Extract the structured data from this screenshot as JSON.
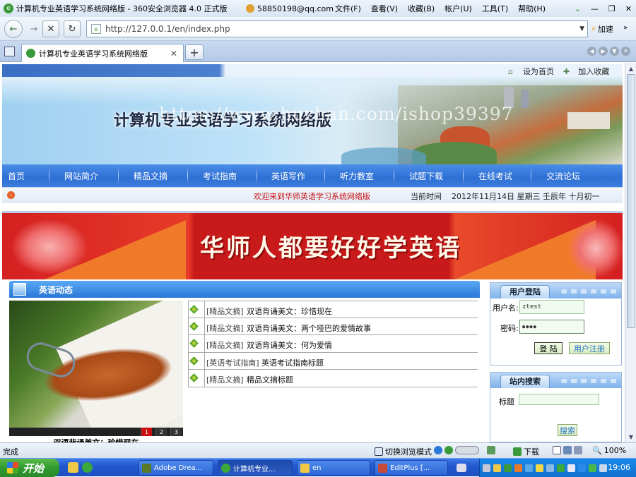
{
  "window": {
    "title": "计算机专业英语学习系统网络版 - 360安全浏览器 4.0 正式版",
    "account": "58850198@qq.com",
    "menus": [
      "文件(F)",
      "查看(V)",
      "收藏(B)",
      "帐户(U)",
      "工具(T)",
      "帮助(H)"
    ],
    "controls": [
      "⌄",
      "—",
      "❐",
      "✕"
    ]
  },
  "toolbar": {
    "url": "http://127.0.0.1/en/index.php",
    "accelerate_label": "加速",
    "more": "»"
  },
  "tabs": [
    {
      "label": "计算机专业英语学习系统网络版",
      "close": "✕"
    }
  ],
  "page": {
    "top_links": [
      "设为首页",
      "加入收藏"
    ],
    "site_title": "计算机专业英语学习系统网络版",
    "watermark": "https://www.huzhan.com/ishop39397",
    "nav": [
      "首页",
      "网站简介",
      "精品文摘",
      "考试指南",
      "英语写作",
      "听力教室",
      "试题下载",
      "在线考试",
      "交流论坛"
    ],
    "welcome": "欢迎来到华师英语学习系统网络版",
    "time_label": "当前时间",
    "time_value": "2012年11月14日  星期三  壬辰年  十月初一",
    "slogan": "华师人都要好好学英语",
    "news_section_title": "英语动态",
    "slide_numbers": [
      "1",
      "2",
      "3"
    ],
    "active_slide": "1",
    "slide_caption": "双语背诵美文：珍惜现在",
    "news": [
      {
        "category": "[精品文摘]",
        "title": "双语背诵美文：珍惜现在"
      },
      {
        "category": "[精品文摘]",
        "title": "双语背诵美文：两个哑巴的爱情故事"
      },
      {
        "category": "[精品文摘]",
        "title": "双语背诵美文：何为爱情"
      },
      {
        "category": "[英语考试指南]",
        "title": "英语考试指南标题"
      },
      {
        "category": "[精品文摘]",
        "title": "精品文摘标题"
      }
    ],
    "login": {
      "title": "用户登陆",
      "username_label": "用户名:",
      "username_value": "ztest",
      "password_label": "密码:",
      "password_value": "●●●●",
      "login_button": "登 陆",
      "register_button": "用户注册"
    },
    "search": {
      "title": "站内搜索",
      "keyword_label": "标题",
      "keyword_value": "",
      "search_button": "搜索"
    }
  },
  "statusbar": {
    "status": "完成",
    "switch_mode": "切换浏览模式",
    "download": "下载",
    "zoom": "100%"
  },
  "taskbar": {
    "start": "开始",
    "items": [
      "Adobe Drea...",
      "计算机专业...",
      "en",
      "EditPlus [..."
    ],
    "clock": "19:06"
  }
}
